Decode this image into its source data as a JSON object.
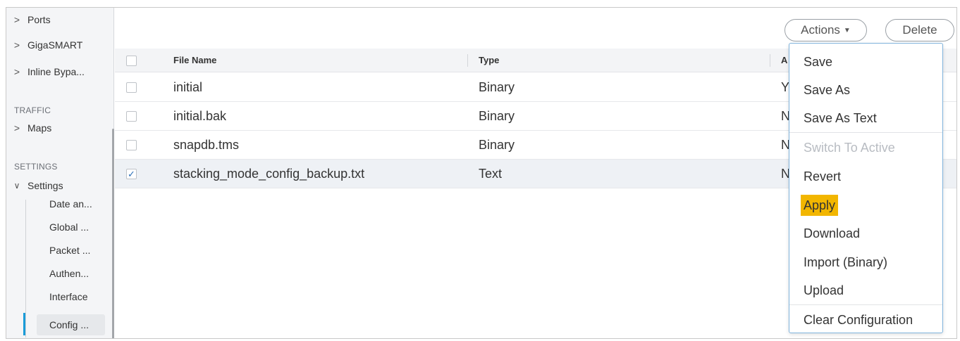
{
  "sidebar": {
    "top_items": [
      {
        "label": "Ports"
      },
      {
        "label": "GigaSMART"
      },
      {
        "label": "Inline Bypa..."
      }
    ],
    "traffic_section": "TRAFFIC",
    "traffic_items": [
      {
        "label": "Maps"
      }
    ],
    "settings_section": "SETTINGS",
    "settings_group": "Settings",
    "settings_items": [
      {
        "label": "Date an..."
      },
      {
        "label": "Global ..."
      },
      {
        "label": "Packet ..."
      },
      {
        "label": "Authen..."
      },
      {
        "label": "Interface"
      },
      {
        "label": "Config ...",
        "active": true
      }
    ]
  },
  "toolbar": {
    "actions_label": "Actions",
    "delete_label": "Delete"
  },
  "table": {
    "headers": [
      "File Name",
      "Type",
      "A"
    ],
    "rows": [
      {
        "name": "initial",
        "type": "Binary",
        "third": "Y",
        "checked": false
      },
      {
        "name": "initial.bak",
        "type": "Binary",
        "third": "N",
        "checked": false
      },
      {
        "name": "snapdb.tms",
        "type": "Binary",
        "third": "N",
        "checked": false
      },
      {
        "name": "stacking_mode_config_backup.txt",
        "type": "Text",
        "third": "N",
        "checked": true
      }
    ]
  },
  "actions_menu": {
    "items": [
      {
        "label": "Save"
      },
      {
        "label": "Save As"
      },
      {
        "label": "Save As Text"
      },
      {
        "label": "Switch To Active",
        "disabled": true
      },
      {
        "label": "Revert"
      },
      {
        "label": "Apply",
        "highlighted": true
      },
      {
        "label": "Download"
      },
      {
        "label": "Import (Binary)"
      },
      {
        "label": "Upload"
      },
      {
        "label": "Clear Configuration"
      }
    ]
  },
  "colors": {
    "highlight": "#f2b600",
    "active_bar": "#1a9bd8",
    "menu_border": "#7fb3dc"
  }
}
